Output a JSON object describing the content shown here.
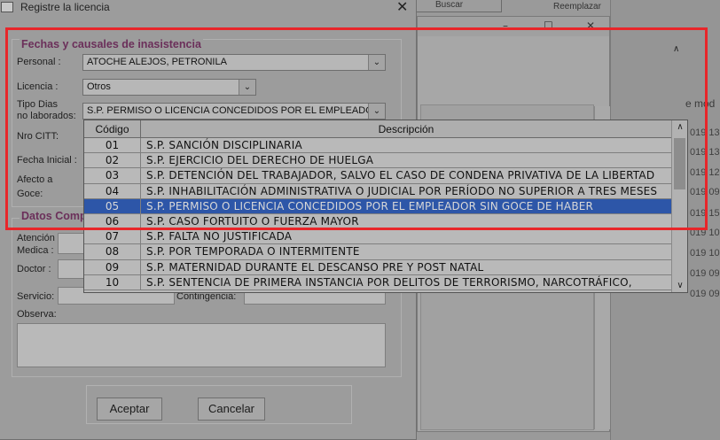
{
  "dialog": {
    "title": "Registre la licencia",
    "close": "✕"
  },
  "group1": {
    "title": "Fechas y causales de inasistencia",
    "personal_label": "Personal :",
    "personal_value": "ATOCHE ALEJOS, PETRONILA",
    "licencia_label": "Licencia :",
    "licencia_value": "Otros",
    "tipo_label_1": "Tipo Dias",
    "tipo_label_2": "no laborados:",
    "tipo_value": "S.P. PERMISO O LICENCIA CONCEDIDOS POR EL EMPLEADOR",
    "nro_citt_label": "Nro CITT:",
    "fecha_inicial_label": "Fecha Inicial :",
    "afecto_label_1": "Afecto a",
    "afecto_label_2": "Goce:"
  },
  "group2": {
    "title": "Datos Comp",
    "atencion_label_1": "Atención",
    "atencion_label_2": "Medica :",
    "doctor_label": "Doctor :",
    "servicio_label": "Servicio:",
    "contingencia_label": "Contingencia:",
    "observa_label": "Observa:"
  },
  "buttons": {
    "accept": "Aceptar",
    "cancel": "Cancelar"
  },
  "dropdown": {
    "header_code": "Código",
    "header_desc": "Descripción",
    "selected_index": 4,
    "rows": [
      {
        "code": "01",
        "desc": "S.P. SANCIÓN DISCIPLINARIA"
      },
      {
        "code": "02",
        "desc": "S.P. EJERCICIO DEL DERECHO DE HUELGA"
      },
      {
        "code": "03",
        "desc": "S.P. DETENCIÓN DEL TRABAJADOR, SALVO EL CASO DE CONDENA PRIVATIVA DE LA LIBERTAD"
      },
      {
        "code": "04",
        "desc": "S.P. INHABILITACIÓN ADMINISTRATIVA O JUDICIAL POR PERÍODO NO SUPERIOR A TRES MESES"
      },
      {
        "code": "05",
        "desc": "S.P. PERMISO O LICENCIA CONCEDIDOS POR EL EMPLEADOR SIN GOCE DE HABER"
      },
      {
        "code": "06",
        "desc": "S.P. CASO FORTUITO O FUERZA MAYOR"
      },
      {
        "code": "07",
        "desc": "S.P. FALTA NO JUSTIFICADA"
      },
      {
        "code": "08",
        "desc": "S.P. POR TEMPORADA O INTERMITENTE"
      },
      {
        "code": "09",
        "desc": "S.P. MATERNIDAD DURANTE EL DESCANSO PRE Y POST NATAL"
      },
      {
        "code": "10",
        "desc": "S.P. SENTENCIA DE PRIMERA INSTANCIA POR DELITOS DE TERRORISMO, NARCOTRÁFICO,"
      }
    ]
  },
  "background": {
    "search_text": "Buscar",
    "replace_text": "Reemplazar",
    "side_text": "e mod",
    "dates": [
      "019 13",
      "019 13",
      "019 12",
      "019 09",
      "019 15",
      "019 10",
      "019 10",
      "019 09",
      "019 09"
    ],
    "colors": {
      "highlight": "#e8262a",
      "selection": "#2d56a8"
    }
  }
}
